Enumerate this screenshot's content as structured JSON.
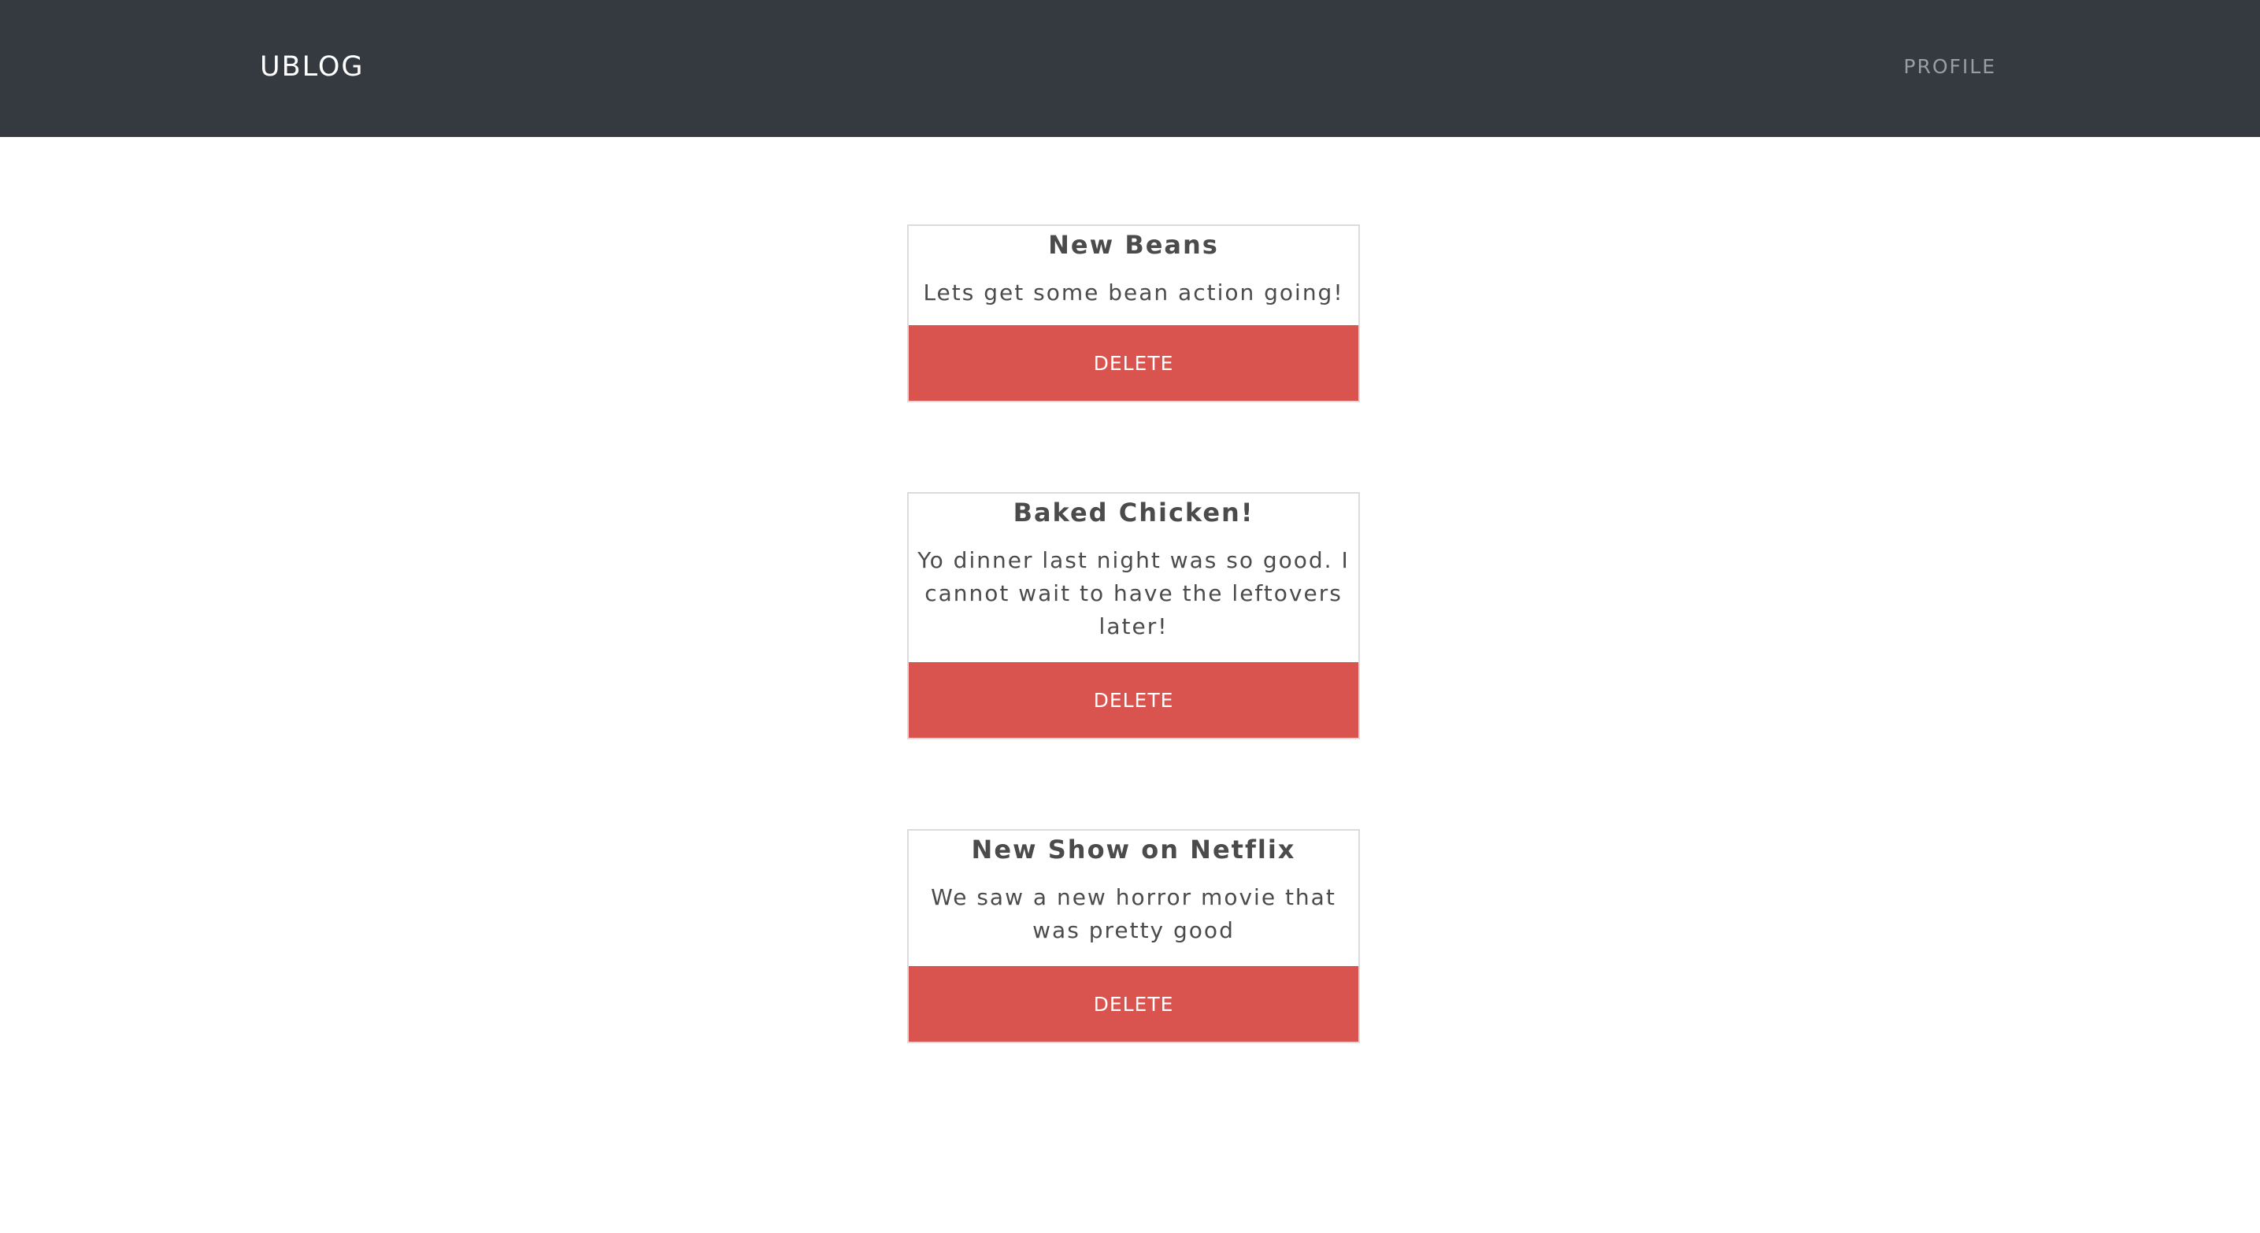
{
  "navbar": {
    "brand": "UBLOG",
    "profile_link": "PROFILE"
  },
  "posts": [
    {
      "title": "New Beans",
      "body": "Lets get some bean action going!",
      "delete_label": "DELETE"
    },
    {
      "title": "Baked Chicken!",
      "body": "Yo dinner last night was so good. I cannot wait to have the leftovers later!",
      "delete_label": "DELETE"
    },
    {
      "title": "New Show on Netflix",
      "body": "We saw a new horror movie that was pretty good",
      "delete_label": "DELETE"
    }
  ],
  "colors": {
    "navbar_bg": "#353a41",
    "brand_text": "#ffffff",
    "nav_link_text": "#9a9da2",
    "delete_button": "#d9534f",
    "card_border": "#dcdcdc",
    "body_text": "#4b4b4b"
  }
}
